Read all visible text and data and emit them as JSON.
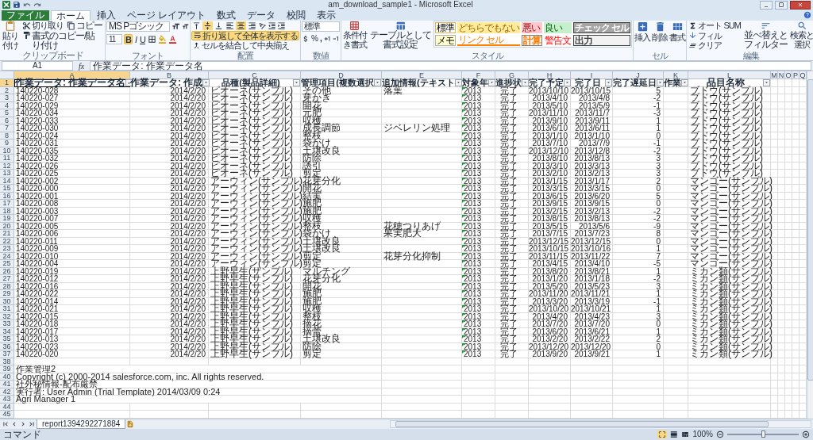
{
  "window": {
    "title": "am_download_sample1 - Microsoft Excel"
  },
  "tabs": [
    {
      "label": "ファイル",
      "kind": "file",
      "selected": false
    },
    {
      "label": "ホーム",
      "kind": "tab",
      "selected": true
    },
    {
      "label": "挿入",
      "kind": "tab",
      "selected": false
    },
    {
      "label": "ページ レイアウト",
      "kind": "tab",
      "selected": false
    },
    {
      "label": "数式",
      "kind": "tab",
      "selected": false
    },
    {
      "label": "データ",
      "kind": "tab",
      "selected": false
    },
    {
      "label": "校閲",
      "kind": "tab",
      "selected": false
    },
    {
      "label": "表示",
      "kind": "tab",
      "selected": false
    }
  ],
  "clipboard": {
    "label": "クリップボード",
    "paste": "貼り付け",
    "cut": "切り取り",
    "copy": "コピー",
    "format_painter": "書式のコピー/貼り付け"
  },
  "font": {
    "label": "フォント",
    "name": "MS Pゴシック",
    "size": "11",
    "bold": {
      "label": "B",
      "on": true
    },
    "italic": {
      "label": "I",
      "on": false
    },
    "underline": {
      "label": "U",
      "on": false
    }
  },
  "alignment": {
    "label": "配置",
    "vertical": [
      {
        "selected": false
      },
      {
        "selected": true
      },
      {
        "selected": false
      }
    ],
    "horizontal": [
      {
        "selected": false
      },
      {
        "selected": true
      },
      {
        "selected": false
      }
    ],
    "wrap_text": {
      "label": "折り返して全体を表示する",
      "on": true
    },
    "merge": "セルを結合して中央揃え"
  },
  "number": {
    "label": "数値",
    "format": "標準",
    "percent": "%",
    "comma": ","
  },
  "styles": {
    "label": "スタイル",
    "conditional": "条件付き書式",
    "table": "テーブルとして書式設定",
    "gallery": [
      {
        "label": "標準",
        "kind": "normal"
      },
      {
        "label": "どちらでもない",
        "kind": "neutral"
      },
      {
        "label": "悪い",
        "kind": "bad"
      },
      {
        "label": "良い",
        "kind": "good"
      },
      {
        "label": "チェック セル",
        "kind": "check"
      },
      {
        "label": "メモ",
        "kind": "note"
      },
      {
        "label": "リンク セル",
        "kind": "link"
      },
      {
        "label": "計算",
        "kind": "calc"
      },
      {
        "label": "警告文",
        "kind": "warning"
      },
      {
        "label": "出力",
        "kind": "output"
      }
    ]
  },
  "cells": {
    "label": "セル",
    "insert": "挿入",
    "delete": "削除",
    "format": "書式"
  },
  "editing": {
    "label": "編集",
    "autosum": "オート SUM",
    "fill": "フィル",
    "clear": "クリア",
    "sort": "並べ替えとフィルター",
    "find": "検索と選択"
  },
  "formula_bar": {
    "name_box": "A1",
    "fx": "fx",
    "formula": "作業データ: 作業データ名"
  },
  "grid": {
    "columns": [
      {
        "letter": "A",
        "selected": true
      },
      {
        "letter": "B",
        "selected": false
      },
      {
        "letter": "C",
        "selected": false
      },
      {
        "letter": "D",
        "selected": false
      },
      {
        "letter": "E",
        "selected": false
      },
      {
        "letter": "F",
        "selected": false,
        "warning": true
      },
      {
        "letter": "G",
        "selected": false
      },
      {
        "letter": "H",
        "selected": false
      },
      {
        "letter": "I",
        "selected": false
      },
      {
        "letter": "J",
        "selected": false
      },
      {
        "letter": "K",
        "selected": false
      },
      {
        "letter": "L",
        "selected": false
      },
      {
        "letter": "M",
        "selected": false
      },
      {
        "letter": "N",
        "selected": false
      },
      {
        "letter": "O",
        "selected": false
      },
      {
        "letter": "P",
        "selected": false
      },
      {
        "letter": "Q",
        "selected": false
      }
    ],
    "header": {
      "number": "1",
      "selected": true,
      "cells": {
        "A": "作業データ: 作業データ名",
        "B": "作業データ: 作成",
        "C": "品種(製品詳細)",
        "D": "管理項目(複数選択",
        "E": "追加情報(テキスト",
        "F": "対象年",
        "G": "進捗状",
        "H": "完了予定",
        "I": "完了日",
        "J": "完了遅延日",
        "K": "作業",
        "L": "品目名称"
      }
    },
    "rows": [
      {
        "number": "2",
        "cells": {
          "A": "140220-028",
          "B": "2014/2/20",
          "C": "ピオーネ(サンプル)",
          "D": "その他",
          "E": "落葉",
          "F": "2013",
          "G": "完了",
          "H": "2013/10/10",
          "I": "2013/10/15",
          "J": "5",
          "L": "ブドウ(サンプル)"
        }
      },
      {
        "number": "3",
        "cells": {
          "A": "140220-027",
          "B": "2014/2/20",
          "C": "ピオーネ(サンプル)",
          "D": "芽かき",
          "F": "2013",
          "G": "完了",
          "H": "2013/4/10",
          "I": "2013/4/8",
          "J": "-2",
          "L": "ブドウ(サンプル)"
        }
      },
      {
        "number": "4",
        "cells": {
          "A": "140220-029",
          "B": "2014/2/20",
          "C": "ピオーネ(サンプル)",
          "D": "開花",
          "F": "2013",
          "G": "完了",
          "H": "2013/5/10",
          "I": "2013/5/9",
          "J": "-1",
          "L": "ブドウ(サンプル)"
        }
      },
      {
        "number": "5",
        "cells": {
          "A": "140220-034",
          "B": "2014/2/20",
          "C": "ピオーネ(サンプル)",
          "D": "元肥",
          "F": "2013",
          "G": "完了",
          "H": "2013/11/10",
          "I": "2013/11/7",
          "J": "-3",
          "L": "ブドウ(サンプル)"
        }
      },
      {
        "number": "6",
        "cells": {
          "A": "140220-033",
          "B": "2014/2/20",
          "C": "ピオーネ(サンプル)",
          "D": "収穫",
          "F": "2013",
          "G": "完了",
          "H": "2013/9/10",
          "I": "2013/9/11",
          "J": "1",
          "L": "ブドウ(サンプル)"
        }
      },
      {
        "number": "7",
        "cells": {
          "A": "140220-030",
          "B": "2014/2/20",
          "C": "ピオーネ(サンプル)",
          "D": "成長調節",
          "E": "ジベレリン処理",
          "F": "2013",
          "G": "完了",
          "H": "2013/6/10",
          "I": "2013/6/11",
          "J": "1",
          "L": "ブドウ(サンプル)"
        }
      },
      {
        "number": "8",
        "cells": {
          "A": "140220-024",
          "B": "2014/2/20",
          "C": "ピオーネ(サンプル)",
          "D": "整枝",
          "F": "2013",
          "G": "完了",
          "H": "2013/1/10",
          "I": "2013/1/10",
          "J": "0",
          "L": "ブドウ(サンプル)"
        }
      },
      {
        "number": "9",
        "cells": {
          "A": "140220-031",
          "B": "2014/2/20",
          "C": "ピオーネ(サンプル)",
          "D": "袋かけ",
          "F": "2013",
          "G": "完了",
          "H": "2013/7/10",
          "I": "2013/7/9",
          "J": "-1",
          "L": "ブドウ(サンプル)"
        }
      },
      {
        "number": "10",
        "cells": {
          "A": "140220-035",
          "B": "2014/2/20",
          "C": "ピオーネ(サンプル)",
          "D": "土壌改良",
          "F": "2013",
          "G": "完了",
          "H": "2013/12/10",
          "I": "2013/12/8",
          "J": "-2",
          "L": "ブドウ(サンプル)"
        }
      },
      {
        "number": "11",
        "cells": {
          "A": "140220-032",
          "B": "2014/2/20",
          "C": "ピオーネ(サンプル)",
          "D": "防除",
          "F": "2013",
          "G": "完了",
          "H": "2013/8/10",
          "I": "2013/8/13",
          "J": "3",
          "L": "ブドウ(サンプル)"
        }
      },
      {
        "number": "12",
        "cells": {
          "A": "140220-026",
          "B": "2014/2/20",
          "C": "ピオーネ(サンプル)",
          "D": "誘引",
          "F": "2013",
          "G": "完了",
          "H": "2013/3/10",
          "I": "2013/3/13",
          "J": "3",
          "L": "ブドウ(サンプル)"
        }
      },
      {
        "number": "13",
        "cells": {
          "A": "140220-025",
          "B": "2014/2/20",
          "C": "ピオーネ(サンプル)",
          "D": "剪定",
          "F": "2013",
          "G": "完了",
          "H": "2013/2/10",
          "I": "2013/2/13",
          "J": "3",
          "L": "ブドウ(サンプル)"
        }
      },
      {
        "number": "14",
        "cells": {
          "A": "140220-002",
          "B": "2014/2/20",
          "C": "アーウィン(サンプル)",
          "D": "花芽分化",
          "F": "2013",
          "G": "完了",
          "H": "2013/1/15",
          "I": "2013/1/17",
          "J": "2",
          "L": "マンゴー(サンプル)"
        }
      },
      {
        "number": "15",
        "cells": {
          "A": "140220-000",
          "B": "2014/2/20",
          "C": "アーウィン(サンプル)",
          "D": "開花",
          "F": "2013",
          "G": "完了",
          "H": "2013/3/15",
          "I": "2013/3/15",
          "J": "0",
          "L": "マンゴー(サンプル)"
        }
      },
      {
        "number": "16",
        "cells": {
          "A": "140220-001",
          "B": "2014/2/20",
          "C": "アーウィン(サンプル)",
          "D": "結実",
          "F": "2013",
          "G": "完了",
          "H": "2013/6/15",
          "I": "2013/6/20",
          "J": "5",
          "L": "マンゴー(サンプル)"
        }
      },
      {
        "number": "17",
        "cells": {
          "A": "140220-008",
          "B": "2014/2/20",
          "C": "アーウィン(サンプル)",
          "D": "施肥",
          "F": "2013",
          "G": "完了",
          "H": "2013/9/15",
          "I": "2013/9/15",
          "J": "0",
          "L": "マンゴー(サンプル)"
        }
      },
      {
        "number": "18",
        "cells": {
          "A": "140220-003",
          "B": "2014/2/20",
          "C": "アーウィン(サンプル)",
          "D": "施肥",
          "F": "2013",
          "G": "完了",
          "H": "2013/2/15",
          "I": "2013/2/13",
          "J": "-2",
          "L": "マンゴー(サンプル)"
        }
      },
      {
        "number": "19",
        "cells": {
          "A": "140220-007",
          "B": "2014/2/20",
          "C": "アーウィン(サンプル)",
          "D": "収穫",
          "F": "2013",
          "G": "完了",
          "H": "2013/8/15",
          "I": "2013/8/13",
          "J": "-2",
          "L": "マンゴー(サンプル)"
        }
      },
      {
        "number": "20",
        "cells": {
          "A": "140220-005",
          "B": "2014/2/20",
          "C": "アーウィン(サンプル)",
          "D": "整枝",
          "E": "花穂つりあげ",
          "F": "2013",
          "G": "完了",
          "H": "2013/5/15",
          "I": "2013/5/6",
          "J": "-9",
          "L": "マンゴー(サンプル)"
        }
      },
      {
        "number": "21",
        "cells": {
          "A": "140220-006",
          "B": "2014/2/20",
          "C": "アーウィン(サンプル)",
          "D": "袋かけ",
          "E": "果実肥大",
          "F": "2013",
          "G": "完了",
          "H": "2013/7/15",
          "I": "2013/7/23",
          "J": "8",
          "L": "マンゴー(サンプル)"
        }
      },
      {
        "number": "22",
        "cells": {
          "A": "140220-011",
          "B": "2014/2/20",
          "C": "アーウィン(サンプル)",
          "D": "土壌改良",
          "F": "2013",
          "G": "完了",
          "H": "2013/12/15",
          "I": "2013/12/15",
          "J": "0",
          "L": "マンゴー(サンプル)"
        }
      },
      {
        "number": "23",
        "cells": {
          "A": "140220-009",
          "B": "2014/2/20",
          "C": "アーウィン(サンプル)",
          "D": "土壌改良",
          "F": "2013",
          "G": "完了",
          "H": "2013/10/15",
          "I": "2013/10/16",
          "J": "1",
          "L": "マンゴー(サンプル)"
        }
      },
      {
        "number": "24",
        "cells": {
          "A": "140220-010",
          "B": "2014/2/20",
          "C": "アーウィン(サンプル)",
          "D": "剪定",
          "E": "花芽分化抑制",
          "F": "2013",
          "G": "完了",
          "H": "2013/11/15",
          "I": "2013/11/22",
          "J": "7",
          "L": "マンゴー(サンプル)"
        }
      },
      {
        "number": "25",
        "cells": {
          "A": "140220-004",
          "B": "2014/2/20",
          "C": "アーウィン(サンプル)",
          "D": "剪定",
          "F": "2013",
          "G": "完了",
          "H": "2013/4/15",
          "I": "2013/4/10",
          "J": "-5",
          "L": "マンゴー(サンプル)"
        }
      },
      {
        "number": "26",
        "cells": {
          "A": "140220-019",
          "B": "2014/2/20",
          "C": "上野早生(サンプル)",
          "D": "マルチング",
          "F": "2013",
          "G": "完了",
          "H": "2013/8/20",
          "I": "2013/8/21",
          "J": "1",
          "L": "ミカン類(サンプル)"
        }
      },
      {
        "number": "27",
        "cells": {
          "A": "140220-012",
          "B": "2014/2/20",
          "C": "上野早生(サンプル)",
          "D": "花芽分化",
          "F": "2013",
          "G": "完了",
          "H": "2013/1/20",
          "I": "2013/1/18",
          "J": "-2",
          "L": "ミカン類(サンプル)"
        }
      },
      {
        "number": "28",
        "cells": {
          "A": "140220-016",
          "B": "2014/2/20",
          "C": "上野早生(サンプル)",
          "D": "開花",
          "F": "2013",
          "G": "完了",
          "H": "2013/5/20",
          "I": "2013/5/23",
          "J": "3",
          "L": "ミカン類(サンプル)"
        }
      },
      {
        "number": "29",
        "cells": {
          "A": "140220-022",
          "B": "2014/2/20",
          "C": "上野早生(サンプル)",
          "D": "施肥",
          "F": "2013",
          "G": "完了",
          "H": "2013/11/20",
          "I": "2013/11/21",
          "J": "1",
          "L": "ミカン類(サンプル)"
        }
      },
      {
        "number": "30",
        "cells": {
          "A": "140220-014",
          "B": "2014/2/20",
          "C": "上野早生(サンプル)",
          "D": "施肥",
          "F": "2013",
          "G": "完了",
          "H": "2013/3/20",
          "I": "2013/3/19",
          "J": "-1",
          "L": "ミカン類(サンプル)"
        }
      },
      {
        "number": "31",
        "cells": {
          "A": "140220-021",
          "B": "2014/2/20",
          "C": "上野早生(サンプル)",
          "D": "収穫",
          "F": "2013",
          "G": "完了",
          "H": "2013/10/20",
          "I": "2013/10/21",
          "J": "1",
          "L": "ミカン類(サンプル)"
        }
      },
      {
        "number": "32",
        "cells": {
          "A": "140220-015",
          "B": "2014/2/20",
          "C": "上野早生(サンプル)",
          "D": "整枝",
          "F": "2013",
          "G": "完了",
          "H": "2013/4/20",
          "I": "2013/4/23",
          "J": "3",
          "L": "ミカン類(サンプル)"
        }
      },
      {
        "number": "33",
        "cells": {
          "A": "140220-018",
          "B": "2014/2/20",
          "C": "上野早生(サンプル)",
          "D": "摘花",
          "F": "2013",
          "G": "完了",
          "H": "2013/7/20",
          "I": "2013/7/20",
          "J": "0",
          "L": "ミカン類(サンプル)"
        }
      },
      {
        "number": "34",
        "cells": {
          "A": "140220-017",
          "B": "2014/2/20",
          "C": "上野早生(サンプル)",
          "D": "摘蕾",
          "F": "2013",
          "G": "完了",
          "H": "2013/6/20",
          "I": "2013/6/21",
          "J": "1",
          "L": "ミカン類(サンプル)"
        }
      },
      {
        "number": "35",
        "cells": {
          "A": "140220-013",
          "B": "2014/2/20",
          "C": "上野早生(サンプル)",
          "D": "土壌改良",
          "F": "2013",
          "G": "完了",
          "H": "2013/2/20",
          "I": "2013/2/22",
          "J": "2",
          "L": "ミカン類(サンプル)"
        }
      },
      {
        "number": "36",
        "cells": {
          "A": "140220-023",
          "B": "2014/2/20",
          "C": "上野早生(サンプル)",
          "D": "防除",
          "F": "2013",
          "G": "完了",
          "H": "2013/12/20",
          "I": "2013/12/20",
          "J": "0",
          "L": "ミカン類(サンプル)"
        }
      },
      {
        "number": "37",
        "cells": {
          "A": "140220-020",
          "B": "2014/2/20",
          "C": "上野早生(サンプル)",
          "D": "剪定",
          "F": "2013",
          "G": "完了",
          "H": "2013/9/20",
          "I": "2013/9/21",
          "J": "1",
          "L": "ミカン類(サンプル)"
        }
      },
      {
        "number": "38",
        "cells": {}
      },
      {
        "number": "39",
        "cells": {
          "A": "作業管理2"
        }
      },
      {
        "number": "40",
        "cells": {
          "A": "Copyright (c) 2000-2014 salesforce.com, inc. All rights reserved."
        }
      },
      {
        "number": "41",
        "cells": {
          "A": "社外秘情報-配布厳禁"
        }
      },
      {
        "number": "42",
        "cells": {
          "A": "実行者: User Admin (Trial Template) 2014/03/09 0:24"
        }
      },
      {
        "number": "43",
        "cells": {
          "A": "Agri Manager 1"
        }
      },
      {
        "number": "44",
        "cells": {}
      },
      {
        "number": "45",
        "cells": {}
      }
    ]
  },
  "sheet_tabs": [
    {
      "label": "report1394292271884",
      "selected": true
    }
  ],
  "status_bar": {
    "mode": "コマンド",
    "zoom": "100%",
    "zoom_slider": {
      "level": 0.5
    }
  }
}
